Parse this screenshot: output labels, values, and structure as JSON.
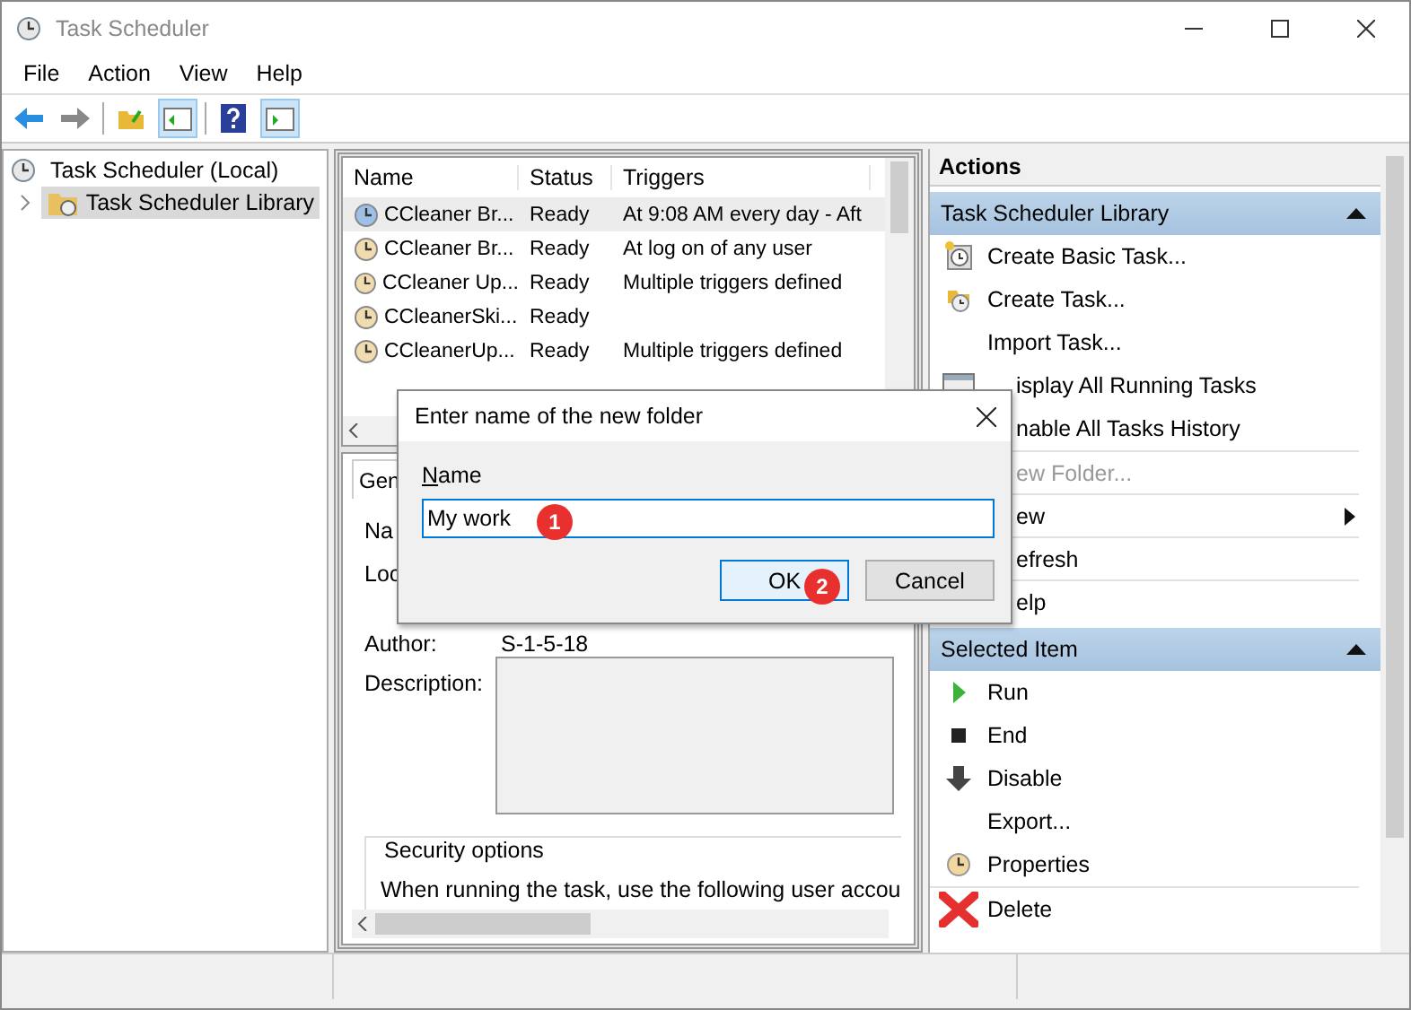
{
  "window": {
    "title": "Task Scheduler"
  },
  "menu": [
    "File",
    "Action",
    "View",
    "Help"
  ],
  "tree": {
    "root": {
      "label": "Task Scheduler (Local)",
      "selected": false
    },
    "children": [
      {
        "label": "Task Scheduler Library",
        "selected": true,
        "expanded": false
      }
    ]
  },
  "task_list": {
    "columns": [
      "Name",
      "Status",
      "Triggers"
    ],
    "rows": [
      {
        "name": "CCleaner Br...",
        "status": "Ready",
        "triggers": "At 9:08 AM every day - Aft",
        "selected": true
      },
      {
        "name": "CCleaner Br...",
        "status": "Ready",
        "triggers": "At log on of any user",
        "selected": false
      },
      {
        "name": "CCleaner Up...",
        "status": "Ready",
        "triggers": "Multiple triggers defined",
        "selected": false
      },
      {
        "name": "CCleanerSki...",
        "status": "Ready",
        "selected": false
      },
      {
        "name": "CCleanerUp...",
        "status": "Ready",
        "triggers": "Multiple triggers defined",
        "selected": false
      }
    ]
  },
  "details": {
    "tabs": [
      {
        "label": "Gen",
        "selected": true
      }
    ],
    "name_label": "Na",
    "location_label": "Loc",
    "author": {
      "label": "Author:",
      "value": "S-1-5-18"
    },
    "description_label": "Description:",
    "security": {
      "title": "Security options",
      "text": "When running the task, use the following user accou"
    }
  },
  "actions": {
    "title": "Actions",
    "sections": [
      {
        "title": "Task Scheduler Library",
        "expanded": true,
        "items": [
          {
            "label": "Create Basic Task...",
            "kind": "action",
            "disabled": false,
            "divider": false
          },
          {
            "label": "Create Task...",
            "kind": "action",
            "disabled": false,
            "divider": false
          },
          {
            "label": "Import Task...",
            "kind": "action",
            "disabled": false,
            "divider": false
          },
          {
            "label": "isplay All Running Tasks",
            "kind": "covered",
            "disabled": false,
            "divider": false
          },
          {
            "label": "nable All Tasks History",
            "kind": "covered",
            "disabled": false,
            "divider": false
          },
          {
            "label": "ew Folder...",
            "kind": "covered",
            "disabled": true,
            "divider": true
          },
          {
            "label": "ew",
            "kind": "covered-submenu",
            "disabled": false,
            "divider": true
          },
          {
            "label": "efresh",
            "kind": "covered",
            "disabled": false,
            "divider": true
          },
          {
            "label": "elp",
            "kind": "covered",
            "disabled": false,
            "divider": true
          }
        ]
      },
      {
        "title": "Selected Item",
        "expanded": true,
        "items": [
          {
            "label": "Run",
            "kind": "action",
            "disabled": false,
            "divider": false
          },
          {
            "label": "End",
            "kind": "action",
            "disabled": false,
            "divider": false
          },
          {
            "label": "Disable",
            "kind": "action",
            "disabled": false,
            "divider": false
          },
          {
            "label": "Export...",
            "kind": "action",
            "disabled": false,
            "divider": false
          },
          {
            "label": "Properties",
            "kind": "action",
            "disabled": false,
            "divider": false
          },
          {
            "label": "Delete",
            "kind": "action",
            "disabled": false,
            "divider": true
          }
        ]
      }
    ]
  },
  "dialog": {
    "title": "Enter name of the new folder",
    "field_label": "Name",
    "value": "My work",
    "field_callout": "1",
    "buttons": [
      {
        "label": "OK",
        "focused": true,
        "callout": "2"
      },
      {
        "label": "Cancel",
        "focused": false
      }
    ]
  }
}
